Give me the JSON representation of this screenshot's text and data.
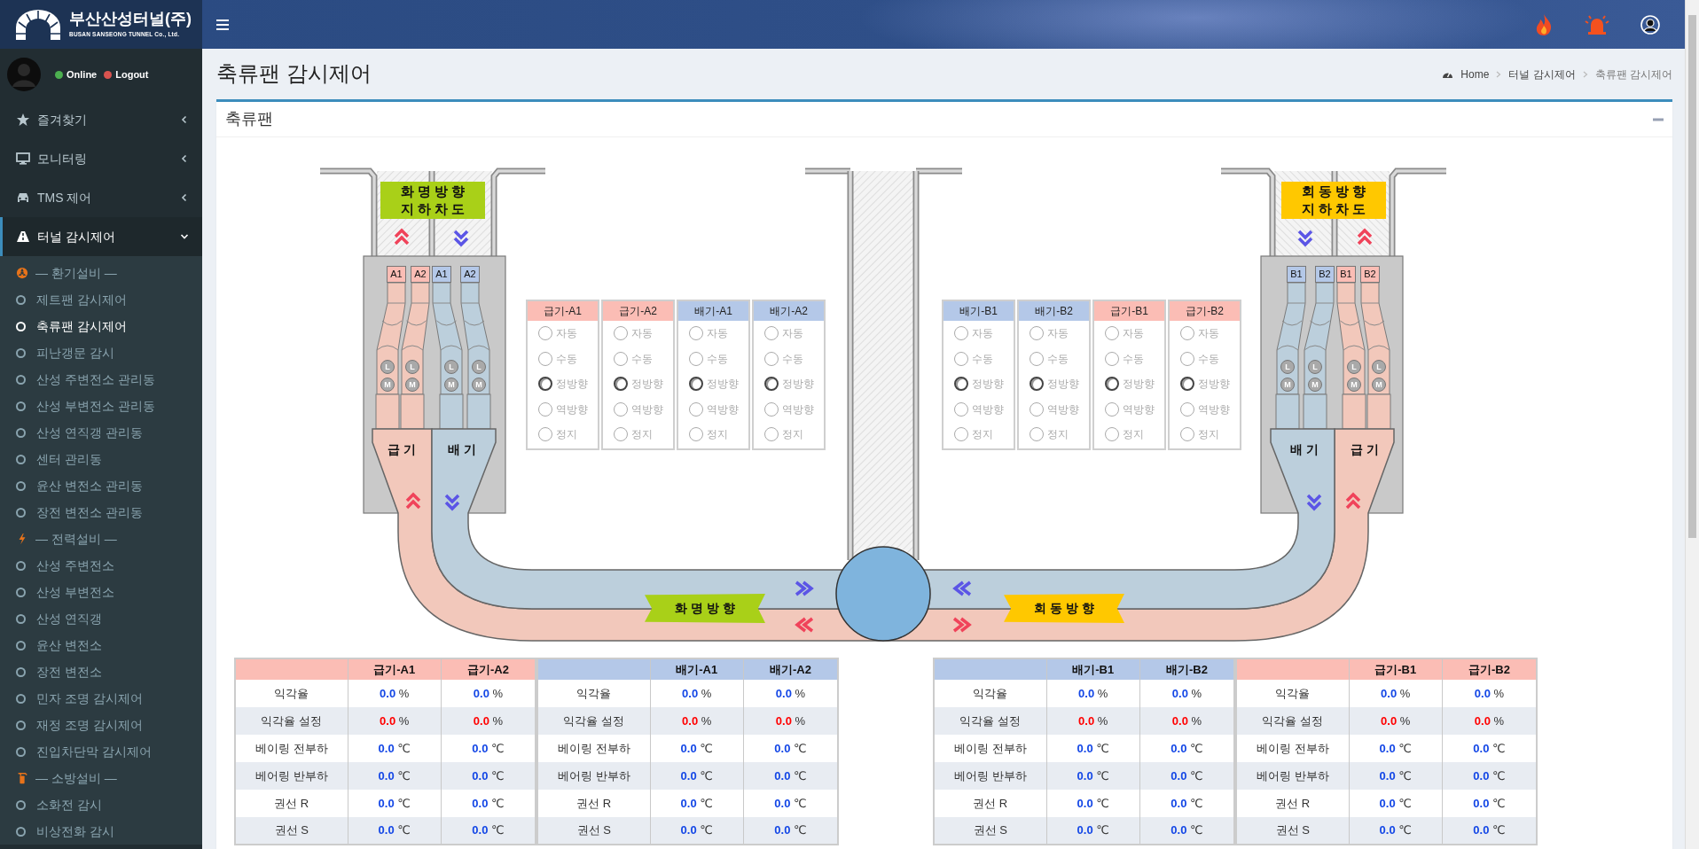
{
  "brand": {
    "name": "부산산성터널(주)",
    "subtitle": "BUSAN SANSEONG TUNNEL Co., Ltd."
  },
  "user": {
    "status": [
      {
        "label": "Online",
        "color": "#4caf50"
      },
      {
        "label": "Logout",
        "color": "#d9534f"
      }
    ]
  },
  "sidebar": {
    "items": [
      {
        "label": "즐겨찾기",
        "selected": false,
        "expanded": false
      },
      {
        "label": "모니터링",
        "selected": false,
        "expanded": false
      },
      {
        "label": "TMS 제어",
        "selected": false,
        "expanded": false
      },
      {
        "label": "터널 감시제어",
        "selected": true,
        "expanded": true,
        "children": [
          {
            "kind": "section",
            "label": "— 환기설비 —"
          },
          {
            "kind": "link",
            "label": "제트팬 감시제어",
            "selected": false
          },
          {
            "kind": "link",
            "label": "축류팬 감시제어",
            "selected": true
          },
          {
            "kind": "link",
            "label": "피난갱문 감시",
            "selected": false
          },
          {
            "kind": "link",
            "label": "산성 주변전소 관리동",
            "selected": false
          },
          {
            "kind": "link",
            "label": "산성 부변전소 관리동",
            "selected": false
          },
          {
            "kind": "link",
            "label": "산성 연직갱 관리동",
            "selected": false
          },
          {
            "kind": "link",
            "label": "센터 관리동",
            "selected": false
          },
          {
            "kind": "link",
            "label": "윤산 변전소 관리동",
            "selected": false
          },
          {
            "kind": "link",
            "label": "장전 변전소 관리동",
            "selected": false
          },
          {
            "kind": "section",
            "label": "— 전력설비 —"
          },
          {
            "kind": "link",
            "label": "산성 주변전소",
            "selected": false
          },
          {
            "kind": "link",
            "label": "산성 부변전소",
            "selected": false
          },
          {
            "kind": "link",
            "label": "산성 연직갱",
            "selected": false
          },
          {
            "kind": "link",
            "label": "윤산 변전소",
            "selected": false
          },
          {
            "kind": "link",
            "label": "장전 변전소",
            "selected": false
          },
          {
            "kind": "link",
            "label": "민자 조명 감시제어",
            "selected": false
          },
          {
            "kind": "link",
            "label": "재정 조명 감시제어",
            "selected": false
          },
          {
            "kind": "link",
            "label": "진입차단막 감시제어",
            "selected": false
          },
          {
            "kind": "section",
            "label": "— 소방설비 —"
          },
          {
            "kind": "link",
            "label": "소화전 감시",
            "selected": false
          },
          {
            "kind": "link",
            "label": "비상전화 감시",
            "selected": false
          }
        ]
      }
    ]
  },
  "page": {
    "title": "축류팬 감시제어",
    "breadcrumb": [
      "Home",
      "터널 감시제어",
      "축류팬 감시제어"
    ]
  },
  "panel": {
    "title": "축류팬"
  },
  "diagram": {
    "sides": [
      {
        "portal_sign": [
          "화 명 방 향",
          "지 하 차 도"
        ],
        "color": "#a9d018",
        "direction": "화 명 방 향",
        "fans": [
          {
            "label": "A1",
            "kind": "supply",
            "indicators": [
              "L",
              "M"
            ]
          },
          {
            "label": "A2",
            "kind": "supply",
            "indicators": [
              "L",
              "M"
            ]
          },
          {
            "label": "A1",
            "kind": "exhaust",
            "indicators": [
              "L",
              "M"
            ]
          },
          {
            "label": "A2",
            "kind": "exhaust",
            "indicators": [
              "L",
              "M"
            ]
          }
        ],
        "ducts": [
          {
            "label": "급 기",
            "kind": "supply"
          },
          {
            "label": "배 기",
            "kind": "exhaust"
          }
        ],
        "control_panels": [
          {
            "title": "급기-A1",
            "kind": "supply",
            "options": [
              {
                "label": "자동",
                "selected": false
              },
              {
                "label": "수동",
                "selected": false
              },
              {
                "label": "정방향",
                "selected": true
              },
              {
                "label": "역방향",
                "selected": false
              },
              {
                "label": "정지",
                "selected": false
              }
            ]
          },
          {
            "title": "급기-A2",
            "kind": "supply",
            "options": [
              {
                "label": "자동",
                "selected": false
              },
              {
                "label": "수동",
                "selected": false
              },
              {
                "label": "정방향",
                "selected": true
              },
              {
                "label": "역방향",
                "selected": false
              },
              {
                "label": "정지",
                "selected": false
              }
            ]
          },
          {
            "title": "배기-A1",
            "kind": "exhaust",
            "options": [
              {
                "label": "자동",
                "selected": false
              },
              {
                "label": "수동",
                "selected": false
              },
              {
                "label": "정방향",
                "selected": true
              },
              {
                "label": "역방향",
                "selected": false
              },
              {
                "label": "정지",
                "selected": false
              }
            ]
          },
          {
            "title": "배기-A2",
            "kind": "exhaust",
            "options": [
              {
                "label": "자동",
                "selected": false
              },
              {
                "label": "수동",
                "selected": false
              },
              {
                "label": "정방향",
                "selected": true
              },
              {
                "label": "역방향",
                "selected": false
              },
              {
                "label": "정지",
                "selected": false
              }
            ]
          }
        ]
      },
      {
        "portal_sign": [
          "회 동 방 향",
          "지 하 차 도"
        ],
        "color": "#ffc800",
        "direction": "회 동 방 향",
        "fans": [
          {
            "label": "B1",
            "kind": "exhaust",
            "indicators": [
              "L",
              "M"
            ]
          },
          {
            "label": "B2",
            "kind": "exhaust",
            "indicators": [
              "L",
              "M"
            ]
          },
          {
            "label": "B1",
            "kind": "supply",
            "indicators": [
              "L",
              "M"
            ]
          },
          {
            "label": "B2",
            "kind": "supply",
            "indicators": [
              "L",
              "M"
            ]
          }
        ],
        "ducts": [
          {
            "label": "배 기",
            "kind": "exhaust"
          },
          {
            "label": "급 기",
            "kind": "supply"
          }
        ],
        "control_panels": [
          {
            "title": "배기-B1",
            "kind": "exhaust",
            "options": [
              {
                "label": "자동",
                "selected": false
              },
              {
                "label": "수동",
                "selected": false
              },
              {
                "label": "정방향",
                "selected": true
              },
              {
                "label": "역방향",
                "selected": false
              },
              {
                "label": "정지",
                "selected": false
              }
            ]
          },
          {
            "title": "배기-B2",
            "kind": "exhaust",
            "options": [
              {
                "label": "자동",
                "selected": false
              },
              {
                "label": "수동",
                "selected": false
              },
              {
                "label": "정방향",
                "selected": true
              },
              {
                "label": "역방향",
                "selected": false
              },
              {
                "label": "정지",
                "selected": false
              }
            ]
          },
          {
            "title": "급기-B1",
            "kind": "supply",
            "options": [
              {
                "label": "자동",
                "selected": false
              },
              {
                "label": "수동",
                "selected": false
              },
              {
                "label": "정방향",
                "selected": true
              },
              {
                "label": "역방향",
                "selected": false
              },
              {
                "label": "정지",
                "selected": false
              }
            ]
          },
          {
            "title": "급기-B2",
            "kind": "supply",
            "options": [
              {
                "label": "자동",
                "selected": false
              },
              {
                "label": "수동",
                "selected": false
              },
              {
                "label": "정방향",
                "selected": true
              },
              {
                "label": "역방향",
                "selected": false
              },
              {
                "label": "정지",
                "selected": false
              }
            ]
          }
        ]
      }
    ]
  },
  "tables": [
    {
      "kind": "supply",
      "columns": [
        "급기-A1",
        "급기-A2"
      ],
      "rows": [
        {
          "label": "익각율",
          "cells": [
            {
              "value": "0.0",
              "unit": "%",
              "kind": "reading"
            },
            {
              "value": "0.0",
              "unit": "%",
              "kind": "reading"
            }
          ]
        },
        {
          "label": "익각율 설정",
          "cells": [
            {
              "value": "0.0",
              "unit": "%",
              "kind": "setpoint"
            },
            {
              "value": "0.0",
              "unit": "%",
              "kind": "setpoint"
            }
          ]
        },
        {
          "label": "베이링 전부하",
          "cells": [
            {
              "value": "0.0",
              "unit": "℃",
              "kind": "reading"
            },
            {
              "value": "0.0",
              "unit": "℃",
              "kind": "reading"
            }
          ]
        },
        {
          "label": "베어링 반부하",
          "cells": [
            {
              "value": "0.0",
              "unit": "℃",
              "kind": "reading"
            },
            {
              "value": "0.0",
              "unit": "℃",
              "kind": "reading"
            }
          ]
        },
        {
          "label": "권선 R",
          "cells": [
            {
              "value": "0.0",
              "unit": "℃",
              "kind": "reading"
            },
            {
              "value": "0.0",
              "unit": "℃",
              "kind": "reading"
            }
          ]
        },
        {
          "label": "권선 S",
          "cells": [
            {
              "value": "0.0",
              "unit": "℃",
              "kind": "reading"
            },
            {
              "value": "0.0",
              "unit": "℃",
              "kind": "reading"
            }
          ]
        }
      ]
    },
    {
      "kind": "exhaust",
      "columns": [
        "배기-A1",
        "배기-A2"
      ],
      "rows": [
        {
          "label": "익각율",
          "cells": [
            {
              "value": "0.0",
              "unit": "%",
              "kind": "reading"
            },
            {
              "value": "0.0",
              "unit": "%",
              "kind": "reading"
            }
          ]
        },
        {
          "label": "익각율 설정",
          "cells": [
            {
              "value": "0.0",
              "unit": "%",
              "kind": "setpoint"
            },
            {
              "value": "0.0",
              "unit": "%",
              "kind": "setpoint"
            }
          ]
        },
        {
          "label": "베이링 전부하",
          "cells": [
            {
              "value": "0.0",
              "unit": "℃",
              "kind": "reading"
            },
            {
              "value": "0.0",
              "unit": "℃",
              "kind": "reading"
            }
          ]
        },
        {
          "label": "베어링 반부하",
          "cells": [
            {
              "value": "0.0",
              "unit": "℃",
              "kind": "reading"
            },
            {
              "value": "0.0",
              "unit": "℃",
              "kind": "reading"
            }
          ]
        },
        {
          "label": "권선 R",
          "cells": [
            {
              "value": "0.0",
              "unit": "℃",
              "kind": "reading"
            },
            {
              "value": "0.0",
              "unit": "℃",
              "kind": "reading"
            }
          ]
        },
        {
          "label": "권선 S",
          "cells": [
            {
              "value": "0.0",
              "unit": "℃",
              "kind": "reading"
            },
            {
              "value": "0.0",
              "unit": "℃",
              "kind": "reading"
            }
          ]
        }
      ]
    },
    {
      "kind": "exhaust",
      "columns": [
        "배기-B1",
        "배기-B2"
      ],
      "rows": [
        {
          "label": "익각율",
          "cells": [
            {
              "value": "0.0",
              "unit": "%",
              "kind": "reading"
            },
            {
              "value": "0.0",
              "unit": "%",
              "kind": "reading"
            }
          ]
        },
        {
          "label": "익각율 설정",
          "cells": [
            {
              "value": "0.0",
              "unit": "%",
              "kind": "setpoint"
            },
            {
              "value": "0.0",
              "unit": "%",
              "kind": "setpoint"
            }
          ]
        },
        {
          "label": "베이링 전부하",
          "cells": [
            {
              "value": "0.0",
              "unit": "℃",
              "kind": "reading"
            },
            {
              "value": "0.0",
              "unit": "℃",
              "kind": "reading"
            }
          ]
        },
        {
          "label": "베어링 반부하",
          "cells": [
            {
              "value": "0.0",
              "unit": "℃",
              "kind": "reading"
            },
            {
              "value": "0.0",
              "unit": "℃",
              "kind": "reading"
            }
          ]
        },
        {
          "label": "권선 R",
          "cells": [
            {
              "value": "0.0",
              "unit": "℃",
              "kind": "reading"
            },
            {
              "value": "0.0",
              "unit": "℃",
              "kind": "reading"
            }
          ]
        },
        {
          "label": "권선 S",
          "cells": [
            {
              "value": "0.0",
              "unit": "℃",
              "kind": "reading"
            },
            {
              "value": "0.0",
              "unit": "℃",
              "kind": "reading"
            }
          ]
        }
      ]
    },
    {
      "kind": "supply",
      "columns": [
        "급기-B1",
        "급기-B2"
      ],
      "rows": [
        {
          "label": "익각율",
          "cells": [
            {
              "value": "0.0",
              "unit": "%",
              "kind": "reading"
            },
            {
              "value": "0.0",
              "unit": "%",
              "kind": "reading"
            }
          ]
        },
        {
          "label": "익각율 설정",
          "cells": [
            {
              "value": "0.0",
              "unit": "%",
              "kind": "setpoint"
            },
            {
              "value": "0.0",
              "unit": "%",
              "kind": "setpoint"
            }
          ]
        },
        {
          "label": "베이링 전부하",
          "cells": [
            {
              "value": "0.0",
              "unit": "℃",
              "kind": "reading"
            },
            {
              "value": "0.0",
              "unit": "℃",
              "kind": "reading"
            }
          ]
        },
        {
          "label": "베어링 반부하",
          "cells": [
            {
              "value": "0.0",
              "unit": "℃",
              "kind": "reading"
            },
            {
              "value": "0.0",
              "unit": "℃",
              "kind": "reading"
            }
          ]
        },
        {
          "label": "권선 R",
          "cells": [
            {
              "value": "0.0",
              "unit": "℃",
              "kind": "reading"
            },
            {
              "value": "0.0",
              "unit": "℃",
              "kind": "reading"
            }
          ]
        },
        {
          "label": "권선 S",
          "cells": [
            {
              "value": "0.0",
              "unit": "℃",
              "kind": "reading"
            },
            {
              "value": "0.0",
              "unit": "℃",
              "kind": "reading"
            }
          ]
        }
      ]
    }
  ]
}
